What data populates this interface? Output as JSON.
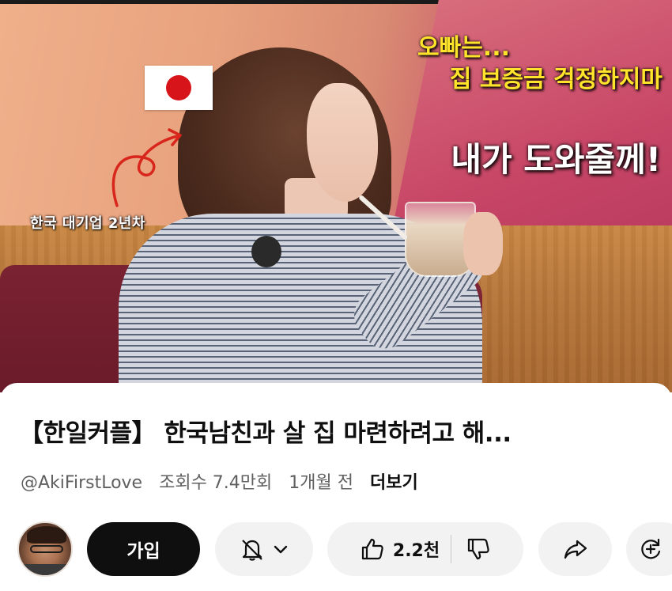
{
  "video": {
    "overlay_line1": "오빠는...",
    "overlay_line2": "집 보증금 걱정하지마",
    "overlay_line3": "내가 도와줄께!",
    "caption_tag": "한국 대기업 2년차",
    "flag_icon": "japan-flag-icon"
  },
  "details": {
    "title": "【한일커플】 한국남친과 살 집 마련하려고 해...",
    "channel": "@AkiFirstLove",
    "views": "조회수 7.4만회",
    "age": "1개월 전",
    "more": "더보기"
  },
  "actions": {
    "join_label": "가입",
    "like_count": "2.2천",
    "icons": [
      "bell-icon",
      "chevron-down-icon",
      "thumbs-up-icon",
      "thumbs-down-icon",
      "share-icon",
      "remix-icon"
    ]
  },
  "colors": {
    "overlay_yellow": "#ffe42b",
    "join_bg": "#0f0f0f",
    "pill_bg": "#f2f2f2",
    "meta_gray": "#606060"
  }
}
